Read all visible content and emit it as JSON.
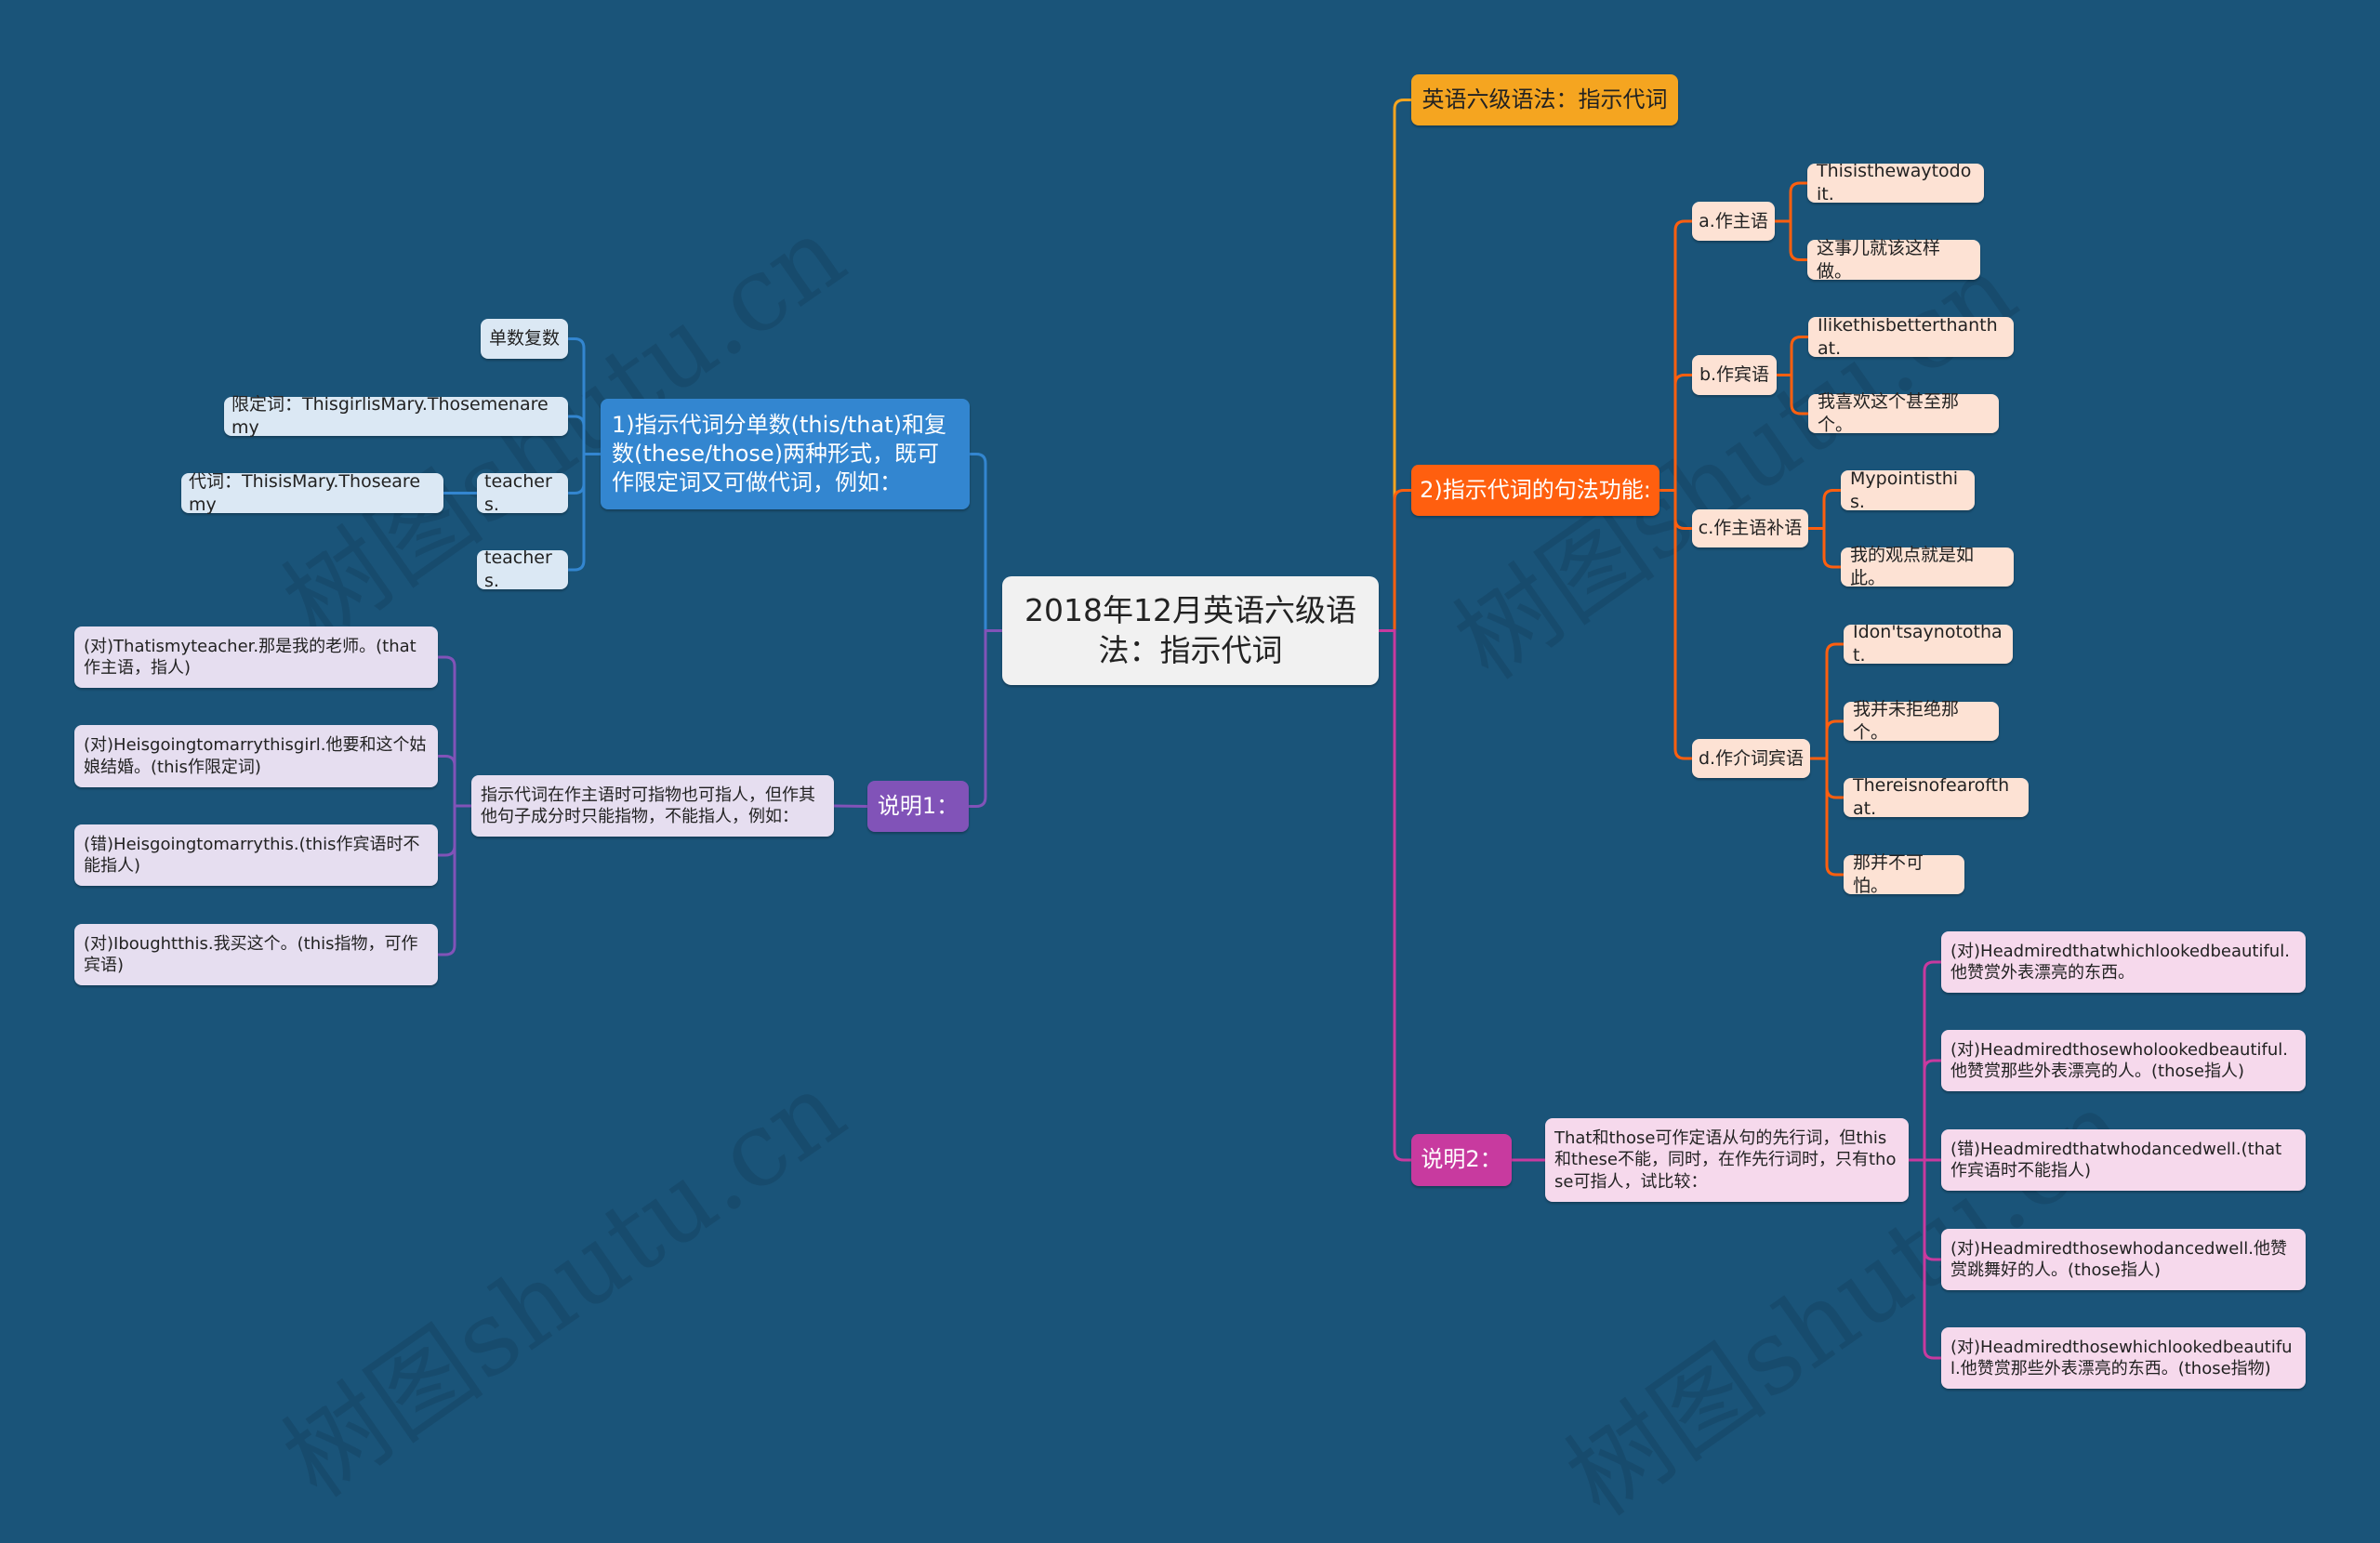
{
  "watermark": "树图shutu.cn",
  "colors": {
    "background": "#1a5479",
    "blue_branch": "#3386d0",
    "purple_branch": "#8153b8",
    "yellow_branch": "#f5a520",
    "orange_branch": "#ff5f0f",
    "magenta_branch": "#c83a9f"
  },
  "root": {
    "label": "2018年12月英语六级语法：指示代词"
  },
  "left": {
    "branch1": {
      "label": "1)指示代词分单数(this/that)和复数(these/those)两种形式，既可作限定词又可做代词，例如：",
      "children": [
        {
          "label": "单数复数"
        },
        {
          "label": "限定词：ThisgirlisMary.Thosemenaremy"
        },
        {
          "label": "teachers.",
          "children": [
            {
              "label": "代词：ThisisMary.Thosearemy"
            }
          ]
        },
        {
          "label": "teachers."
        }
      ]
    },
    "note1": {
      "label": "说明1：",
      "description": "指示代词在作主语时可指物也可指人，但作其他句子成分时只能指物，不能指人，例如：",
      "examples": [
        {
          "label": "(对)Thatismyteacher.那是我的老师。(that作主语，指人)"
        },
        {
          "label": "(对)Heisgoingtomarrythisgirl.他要和这个姑娘结婚。(this作限定词)"
        },
        {
          "label": "(错)Heisgoingtomarrythis.(this作宾语时不能指人)"
        },
        {
          "label": "(对)Iboughtthis.我买这个。(this指物，可作宾语)"
        }
      ]
    }
  },
  "right": {
    "title": {
      "label": "英语六级语法：指示代词"
    },
    "branch2": {
      "label": "2)指示代词的句法功能:",
      "functions": [
        {
          "label": "a.作主语",
          "examples": [
            {
              "label": "Thisisthewaytodoit."
            },
            {
              "label": "这事儿就该这样做。"
            }
          ]
        },
        {
          "label": "b.作宾语",
          "examples": [
            {
              "label": "Ilikethisbetterthanthat."
            },
            {
              "label": "我喜欢这个甚至那个。"
            }
          ]
        },
        {
          "label": "c.作主语补语",
          "examples": [
            {
              "label": "Mypointisthis."
            },
            {
              "label": "我的观点就是如此。"
            }
          ]
        },
        {
          "label": "d.作介词宾语",
          "examples": [
            {
              "label": "Idon'tsaynotothat."
            },
            {
              "label": "我并未拒绝那个。"
            },
            {
              "label": "Thereisnofearofthat."
            },
            {
              "label": "那并不可怕。"
            }
          ]
        }
      ]
    },
    "note2": {
      "label": "说明2：",
      "description": "That和those可作定语从句的先行词，但this和these不能，同时，在作先行词时，只有those可指人，试比较：",
      "examples": [
        {
          "label": "(对)Headmiredthatwhichlookedbeautiful.他赞赏外表漂亮的东西。"
        },
        {
          "label": "(对)Headmiredthosewholookedbeautiful.他赞赏那些外表漂亮的人。(those指人)"
        },
        {
          "label": "(错)Headmiredthatwhodancedwell.(that作宾语时不能指人)"
        },
        {
          "label": "(对)Headmiredthosewhodancedwell.他赞赏跳舞好的人。(those指人)"
        },
        {
          "label": "(对)Headmiredthosewhichlookedbeautiful.他赞赏那些外表漂亮的东西。(those指物)"
        }
      ]
    }
  }
}
